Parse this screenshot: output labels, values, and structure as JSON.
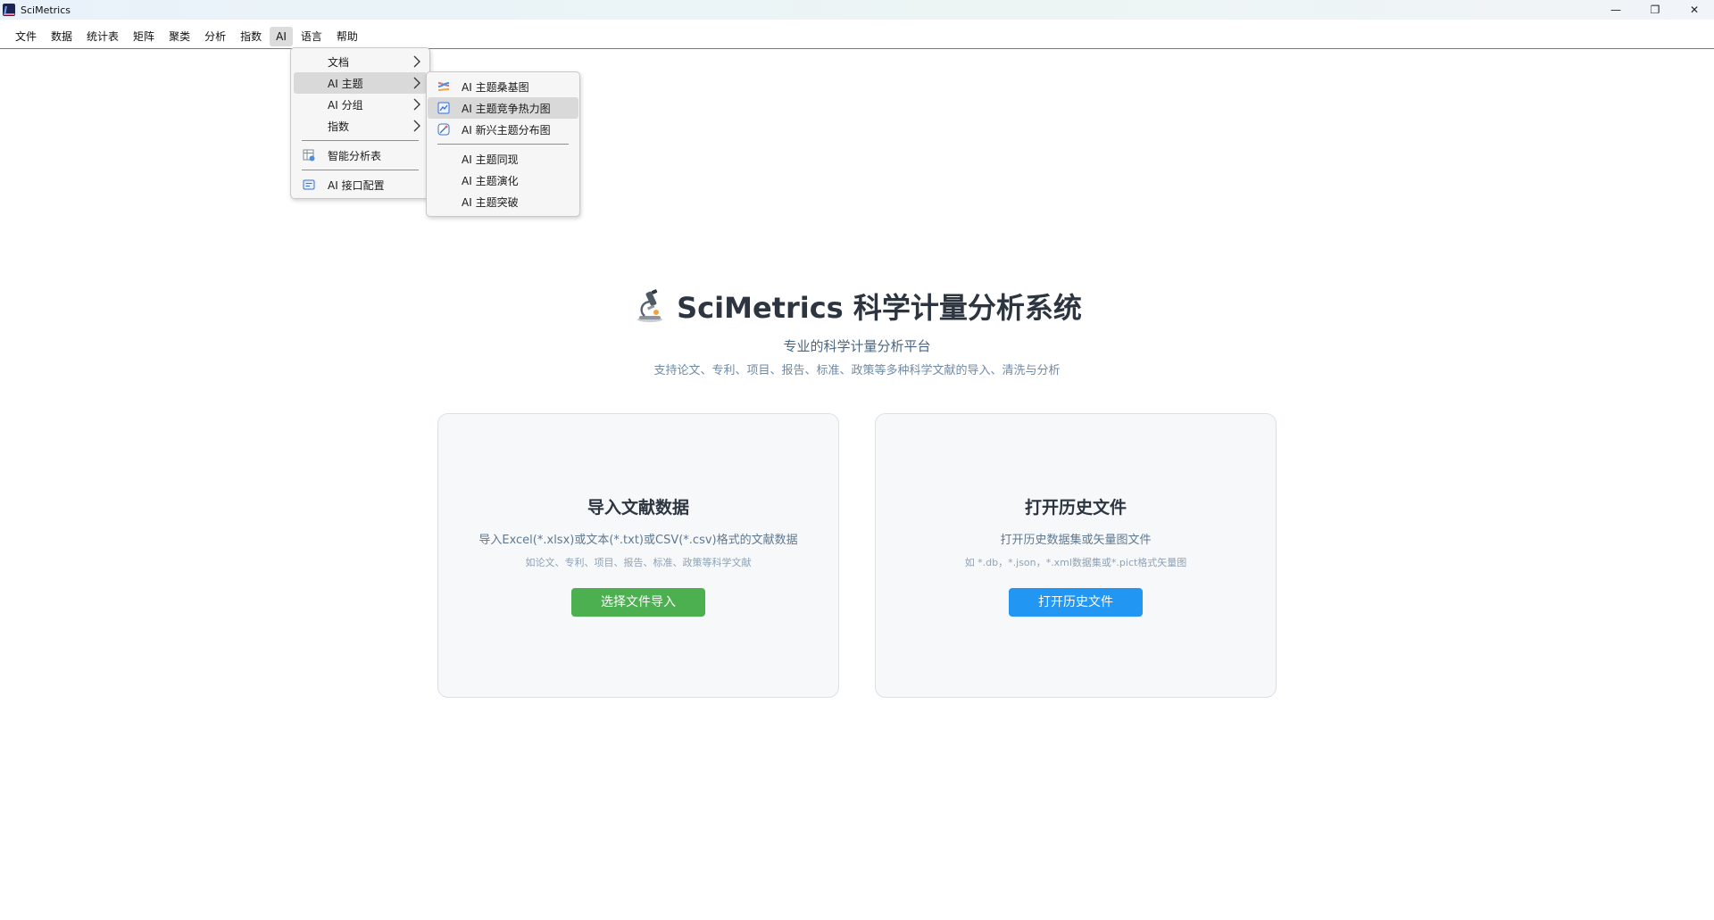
{
  "window": {
    "title": "SciMetrics",
    "controls": {
      "minimize": "—",
      "restore": "❐",
      "close": "✕"
    }
  },
  "menubar": {
    "items": [
      {
        "label": "文件"
      },
      {
        "label": "数据"
      },
      {
        "label": "统计表"
      },
      {
        "label": "矩阵"
      },
      {
        "label": "聚类"
      },
      {
        "label": "分析"
      },
      {
        "label": "指数"
      },
      {
        "label": "AI",
        "active": true
      },
      {
        "label": "语言"
      },
      {
        "label": "帮助"
      }
    ]
  },
  "ai_menu": {
    "items": [
      {
        "label": "文档",
        "submenu": true
      },
      {
        "label": "AI 主题",
        "submenu": true,
        "highlighted": true
      },
      {
        "label": "AI 分组",
        "submenu": true
      },
      {
        "label": "指数",
        "submenu": true
      },
      {
        "label": "智能分析表",
        "icon": "table-chart-icon"
      },
      {
        "label": "AI 接口配置",
        "icon": "api-config-icon"
      }
    ]
  },
  "ai_topic_submenu": {
    "items": [
      {
        "label": "AI 主题桑基图",
        "icon": "sankey-icon"
      },
      {
        "label": "AI 主题竞争热力图",
        "icon": "heatmap-icon",
        "highlighted": true
      },
      {
        "label": "AI 新兴主题分布图",
        "icon": "distribution-icon"
      },
      {
        "label": "AI 主题同现"
      },
      {
        "label": "AI 主题演化"
      },
      {
        "label": "AI 主题突破"
      }
    ]
  },
  "hero": {
    "title": "SciMetrics 科学计量分析系统",
    "subtitle": "专业的科学计量分析平台",
    "description": "支持论文、专利、项目、报告、标准、政策等多种科学文献的导入、清洗与分析"
  },
  "cards": {
    "import": {
      "title": "导入文献数据",
      "description": "导入Excel(*.xlsx)或文本(*.txt)或CSV(*.csv)格式的文献数据",
      "hint": "如论文、专利、项目、报告、标准、政策等科学文献",
      "button": "选择文件导入"
    },
    "history": {
      "title": "打开历史文件",
      "description": "打开历史数据集或矢量图文件",
      "hint": "如 *.db，*.json，*.xml数据集或*.pict格式矢量图",
      "button": "打开历史文件"
    }
  },
  "colors": {
    "import_button": "#4caf50",
    "history_button": "#2196f3",
    "title_text": "#2c3540"
  }
}
